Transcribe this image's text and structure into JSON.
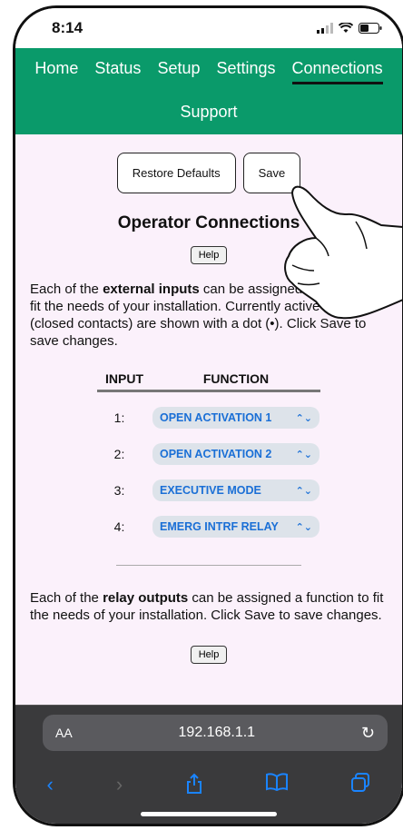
{
  "status_bar": {
    "time": "8:14"
  },
  "nav": {
    "row1": [
      "Home",
      "Status",
      "Setup",
      "Settings",
      "Connections"
    ],
    "row2": [
      "Support"
    ],
    "active": "Connections"
  },
  "buttons": {
    "restore_label": "Restore Defaults",
    "save_label": "Save"
  },
  "title": "Operator Connections",
  "help_label": "Help",
  "intro": {
    "before": "Each of the ",
    "bold": "external inputs",
    "after": " can be assigned a function to fit the needs of your installation. Currently active inputs (closed contacts) are shown with a dot (•). Click Save to save changes."
  },
  "table": {
    "headers": {
      "input": "INPUT",
      "function": "FUNCTION"
    },
    "rows": [
      {
        "num": "1:",
        "function": "OPEN ACTIVATION 1"
      },
      {
        "num": "2:",
        "function": "OPEN ACTIVATION 2"
      },
      {
        "num": "3:",
        "function": "EXECUTIVE MODE"
      },
      {
        "num": "4:",
        "function": "EMERG INTRF RELAY"
      }
    ]
  },
  "relay": {
    "before": "Each of the ",
    "bold": "relay outputs",
    "after": " can be assigned a function to fit the needs of your installation. Click Save to save changes."
  },
  "browser": {
    "text_size": "AA",
    "url": "192.168.1.1"
  },
  "colors": {
    "nav_bg": "#0a9a6a",
    "content_bg": "#fbf1fb",
    "select_text": "#1a6fd6",
    "toolbar_bg": "#3a3a3c"
  }
}
